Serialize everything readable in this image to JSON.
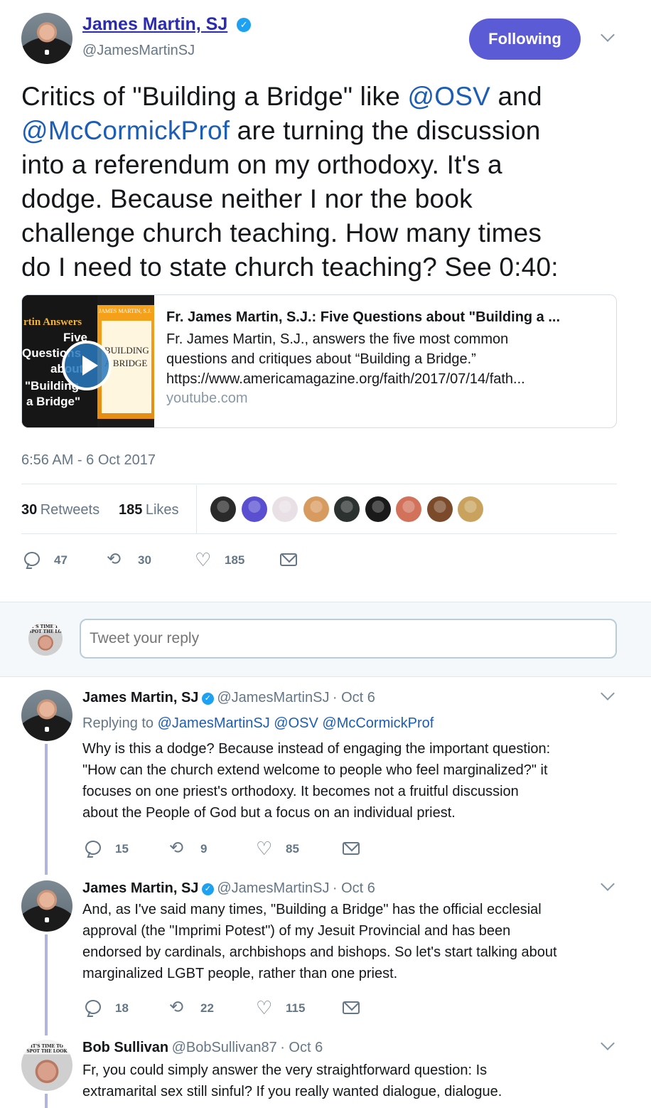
{
  "main_tweet": {
    "author": "James Martin, SJ",
    "handle": "@JamesMartinSJ",
    "follow_button": "Following",
    "text_lines": [
      [
        "Critics of \"Building a Bridge\" like ",
        "@OSV",
        " and"
      ],
      [
        "@McCormickProf",
        " are turning the discussion"
      ],
      [
        "into a referendum on my orthodoxy. It's a"
      ],
      [
        "dodge.  Because neither I nor the book"
      ],
      [
        "challenge church teaching. How many times"
      ],
      [
        "do I need to state church teaching? See 0:40:"
      ]
    ],
    "card": {
      "title": "Fr. James Martin, S.J.: Five Questions about \"Building a ...",
      "description_1": "Fr. James Martin, S.J., answers the five most common",
      "description_2": "questions and critiques about “Building a Bridge.”",
      "link": "https://www.americamagazine.org/faith/2017/07/14/fath...",
      "domain": "youtube.com",
      "thumb_text_1": "rtin Answers",
      "thumb_text_2": "Five",
      "thumb_text_3": "Questions",
      "thumb_text_4": "about",
      "thumb_text_5": "\"Building",
      "thumb_text_6": "a Bridge\"",
      "book_header": "JAMES MARTIN, S.J.",
      "book_title_1": "BUILDING",
      "book_title_2": "A BRIDGE"
    },
    "timestamp": "6:56 AM - 6 Oct 2017",
    "retweets_count": "30",
    "retweets_label": "Retweets",
    "likes_count": "185",
    "likes_label": "Likes",
    "likers_colors": [
      "#2a2a2a",
      "#5a4fd0",
      "#e9e0e6",
      "#d79a5f",
      "#2b3230",
      "#1a1a1a",
      "#d2725a",
      "#7a4a2a",
      "#c9a35e"
    ],
    "actions": {
      "replies": "47",
      "retweets": "30",
      "likes": "185"
    }
  },
  "reply_box": {
    "placeholder": "Tweet your reply"
  },
  "replies": [
    {
      "author": "James Martin, SJ",
      "handle": "@JamesMartinSJ",
      "date": "· Oct 6",
      "replying_label": "Replying to",
      "replying_to": "@JamesMartinSJ @OSV @McCormickProf",
      "lines": [
        "Why is this a dodge? Because instead of engaging the important question:",
        "\"How can the church extend welcome to people who feel marginalized?\" it",
        "focuses on one priest's orthodoxy. It becomes not a fruitful discussion",
        "about the People of God but a focus on an individual priest."
      ],
      "actions": {
        "replies": "15",
        "retweets": "9",
        "likes": "85"
      }
    },
    {
      "author": "James Martin, SJ",
      "handle": "@JamesMartinSJ",
      "date": "· Oct 6",
      "lines": [
        "And, as I've said many times, \"Building a Bridge\" has the official ecclesial",
        "approval (the \"Imprimi Potest\") of my Jesuit Provincial and has been",
        "endorsed by cardinals, archbishops and bishops. So let's start talking about",
        "marginalized LGBT people, rather than one priest."
      ],
      "actions": {
        "replies": "18",
        "retweets": "22",
        "likes": "115"
      }
    },
    {
      "author": "Bob Sullivan",
      "handle": "@BobSullivan87",
      "date": "· Oct 6",
      "lines": [
        "Fr, you could simply answer the very straightforward question: Is",
        "extramarital sex still sinful? If you really wanted dialogue, dialogue."
      ]
    }
  ],
  "colors": {
    "accent": "#5b5bd6",
    "link": "#1c5db5",
    "verified": "#1da1f2",
    "thread": "#b0b4e0"
  }
}
